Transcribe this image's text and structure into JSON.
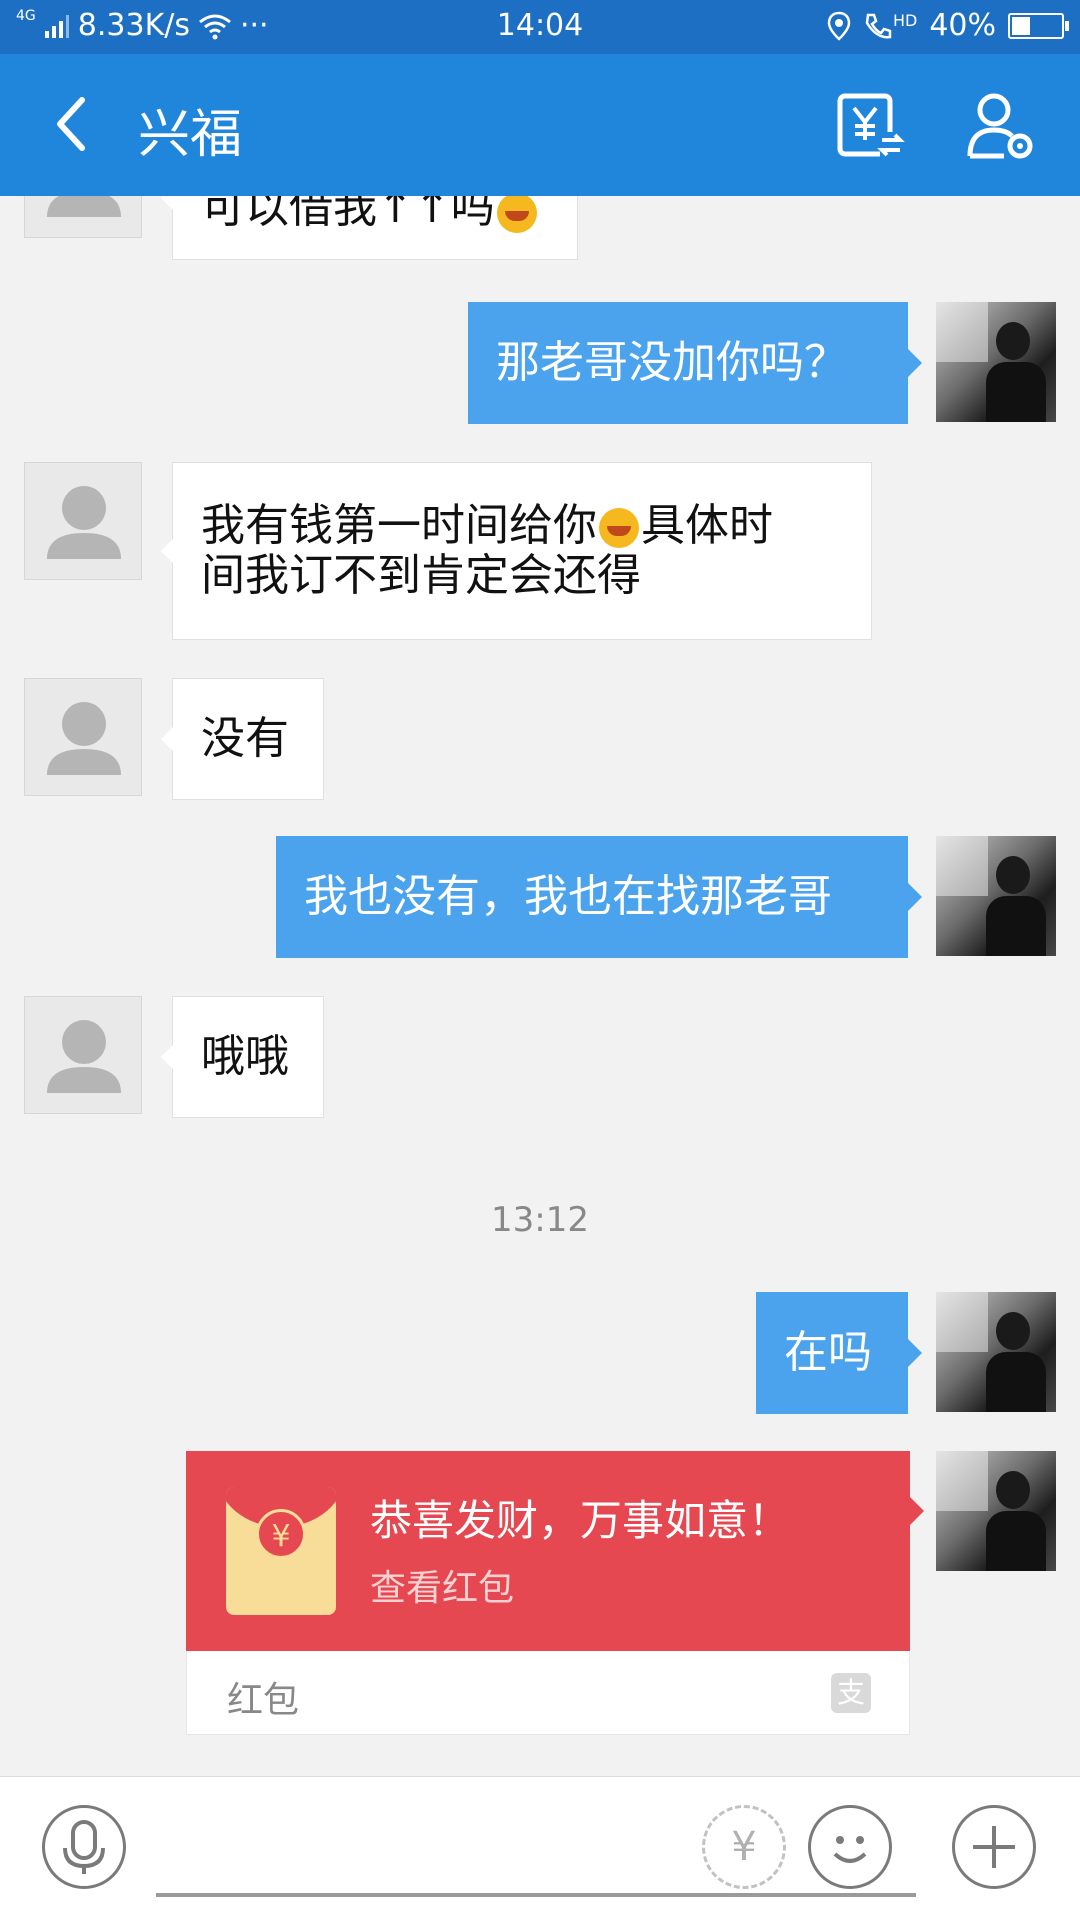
{
  "status_bar": {
    "network_type": "4G",
    "speed": "8.33K/s",
    "more": "···",
    "time": "14:04",
    "battery": "40%",
    "hd_label": "HD"
  },
  "header": {
    "title": "兴福",
    "icons": [
      "back-icon",
      "transfer-icon",
      "profile-settings-icon"
    ]
  },
  "messages": [
    {
      "direction": "in",
      "text_before": "可以借我",
      "text_after": "吗"
    },
    {
      "direction": "out",
      "text": "那老哥没加你吗？"
    },
    {
      "direction": "in",
      "text_line1_before": "我有钱第一时间给你",
      "text_line1_after": "具体时",
      "text_line2": "间我订不到肯定会还得"
    },
    {
      "direction": "in",
      "text": "没有"
    },
    {
      "direction": "out",
      "text": "我也没有，我也在找那老哥"
    },
    {
      "direction": "in",
      "text": "哦哦"
    },
    {
      "direction": "out",
      "text": "在吗"
    }
  ],
  "timestamp": "13:12",
  "red_packet": {
    "greeting": "恭喜发财，万事如意！",
    "action": "查看红包",
    "label": "红包",
    "symbol": "¥",
    "alipay_symbol": "支"
  },
  "input_bar": {
    "icons": [
      "microphone-icon",
      "transfer-money-icon",
      "emoji-icon",
      "plus-icon"
    ],
    "transfer_symbol": "¥",
    "placeholder": ""
  },
  "colors": {
    "status_bar": "#1d6fc4",
    "header": "#1f86dc",
    "outgoing_bubble": "#4aa3ec",
    "red_packet": "#e54850"
  }
}
